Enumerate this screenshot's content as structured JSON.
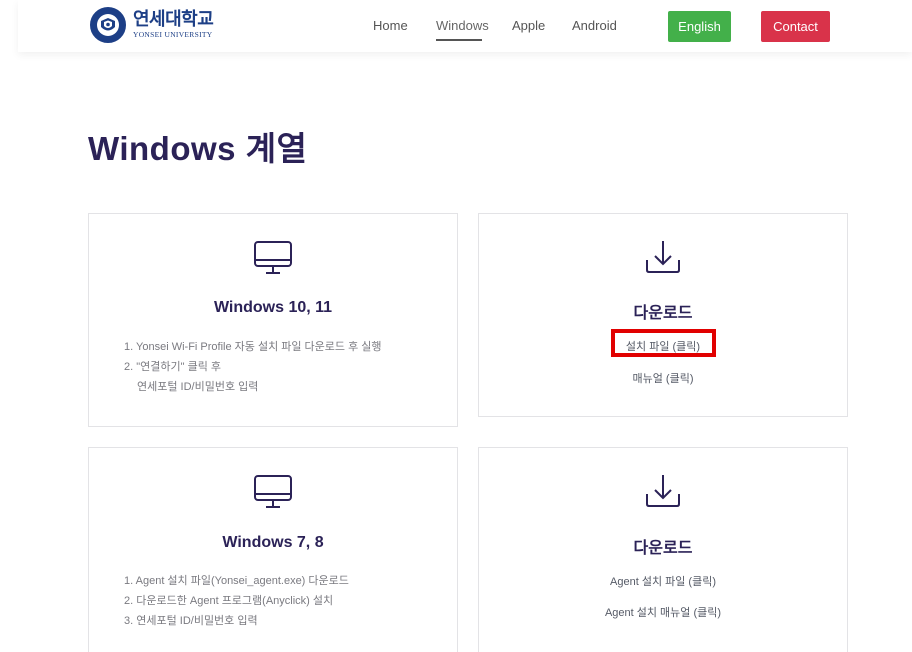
{
  "header": {
    "logo_ko": "연세대학교",
    "logo_en": "YONSEI UNIVERSITY",
    "nav": [
      "Home",
      "Windows",
      "Apple",
      "Android"
    ],
    "active_nav": "Windows",
    "english_label": "English",
    "contact_label": "Contact"
  },
  "page_title": "Windows 계열",
  "cards": {
    "win10": {
      "icon": "monitor-icon",
      "title": "Windows 10, 11",
      "steps": [
        "1. Yonsei Wi-Fi Profile 자동 설치 파일 다운로드 후 실행",
        "2. \"연결하기\" 클릭 후",
        "연세포털 ID/비밀번호 입력"
      ]
    },
    "download1": {
      "icon": "download-icon",
      "title": "다운로드",
      "links": [
        "설치 파일 (클릭)",
        "매뉴얼 (클릭)"
      ]
    },
    "win7": {
      "icon": "monitor-icon",
      "title": "Windows 7, 8",
      "steps": [
        "1. Agent 설치 파일(Yonsei_agent.exe) 다운로드",
        "2. 다운로드한 Agent 프로그램(Anyclick) 설치",
        "3. 연세포털 ID/비밀번호 입력"
      ]
    },
    "download2": {
      "icon": "download-icon",
      "title": "다운로드",
      "links": [
        "Agent 설치 파일 (클릭)",
        "Agent 설치 매뉴얼 (클릭)"
      ]
    }
  },
  "colors": {
    "english_btn": "#43b04a",
    "contact_btn": "#d9334a",
    "title": "#2b2257",
    "highlight": "#e10000"
  }
}
